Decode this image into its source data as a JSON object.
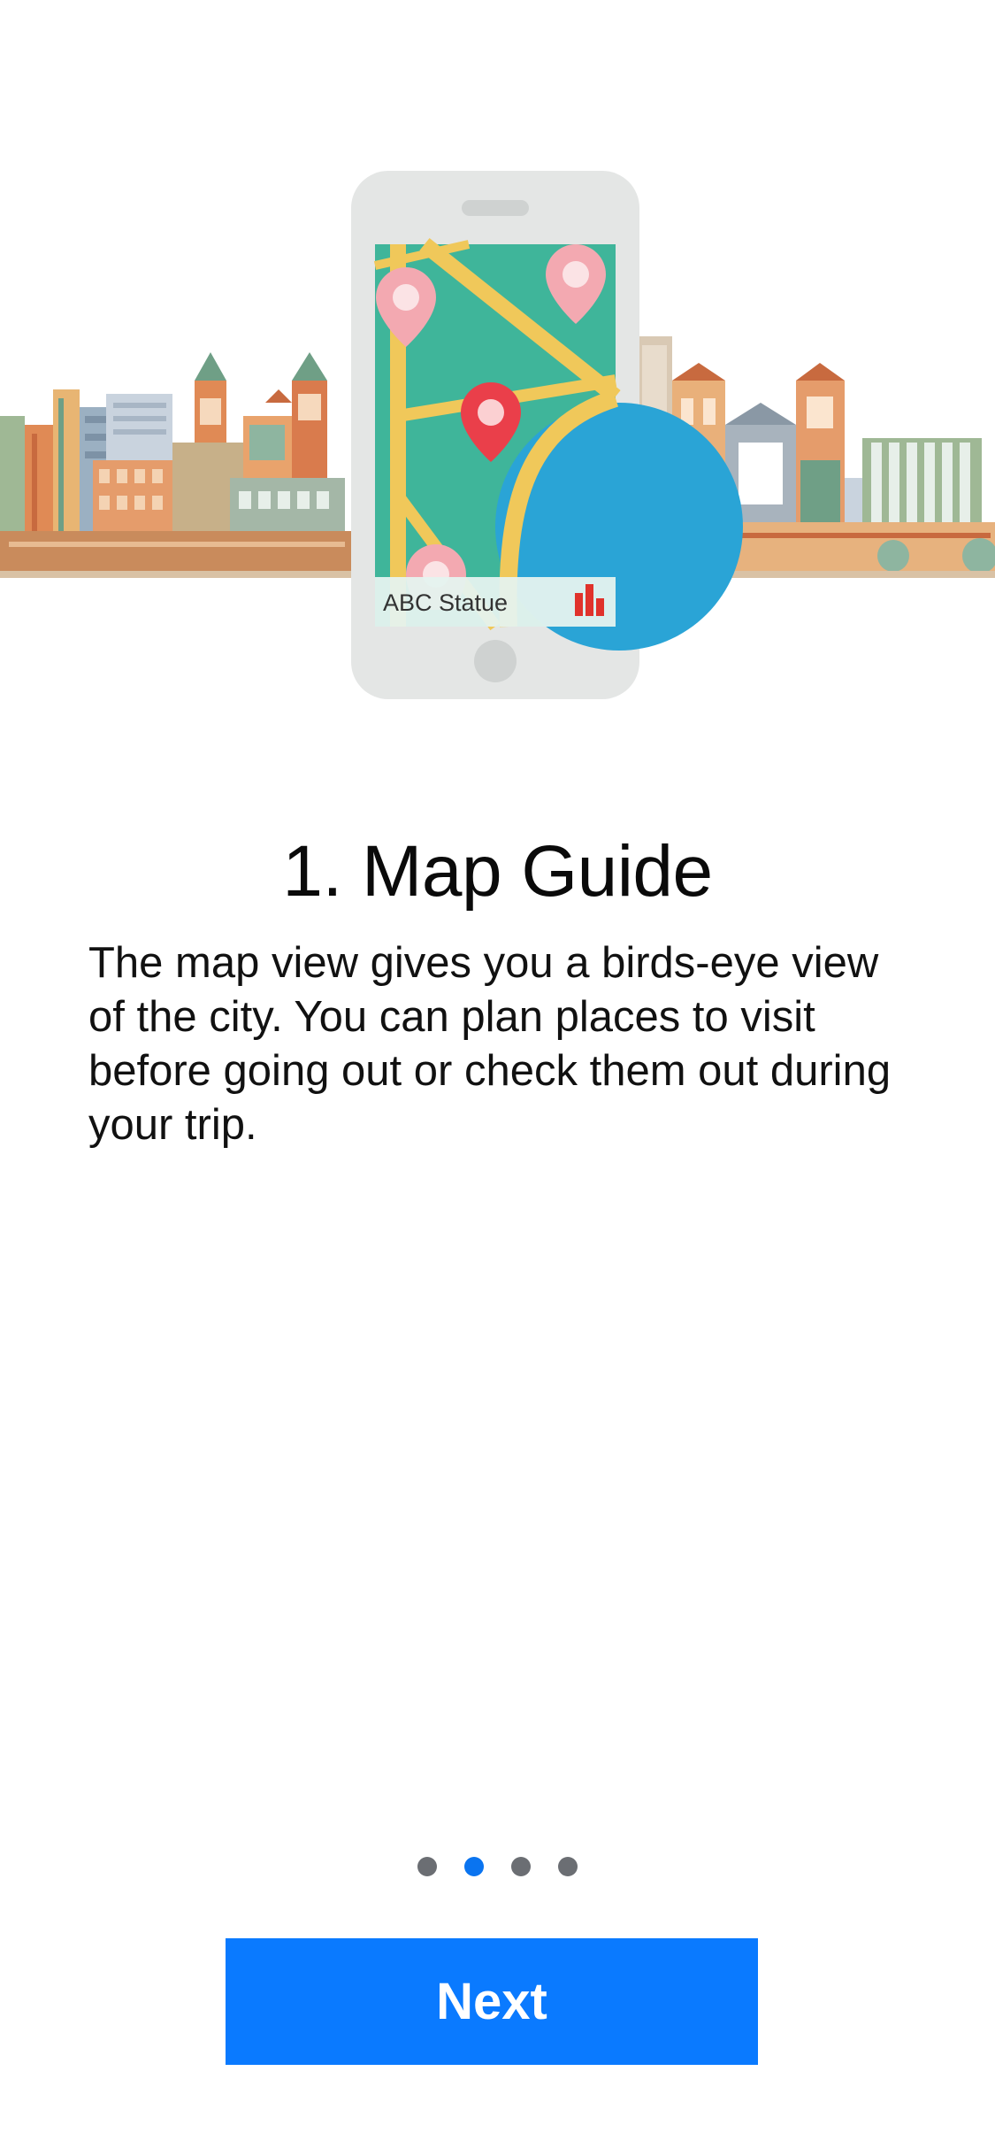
{
  "illustration": {
    "phone_caption": "ABC Statue",
    "colors": {
      "map_green": "#3fb59a",
      "road_yellow": "#f0c85a",
      "water_blue": "#2aa4d6",
      "pin_red": "#ea3f4a",
      "pin_pink": "#f3a9b1",
      "phone_body": "#e4e6e5"
    }
  },
  "onboarding": {
    "title": "1. Map Guide",
    "description": "The map view gives you a birds-eye view of the city. You can plan places to visit before going out or check them out during your trip."
  },
  "pagination": {
    "total_pages": 4,
    "current_page": 2,
    "active_color": "#0a74f0",
    "inactive_color": "#6b6e73"
  },
  "actions": {
    "next_label": "Next",
    "button_color": "#0a7aff"
  }
}
